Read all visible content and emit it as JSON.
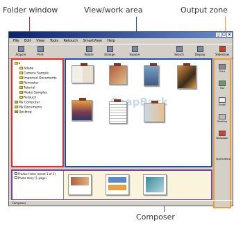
{
  "callouts": {
    "folder_window": "Folder window",
    "view_work_area": "View/work area",
    "output_zone": "Output zone",
    "composer": "Composer"
  },
  "colors": {
    "folder_border": "#e8272a",
    "view_border": "#1e4fa8",
    "output_border": "#f29a2e",
    "composer_border": "#7b3fa0"
  },
  "menu": [
    "File",
    "Edit",
    "View",
    "Tools",
    "Retouch",
    "SmartView",
    "Help"
  ],
  "toolbar": [
    {
      "label": "Acquire",
      "icon": "camera-icon"
    },
    {
      "label": "Print",
      "icon": "printer-icon"
    },
    {
      "label": "Rotate",
      "icon": "rotate-icon"
    },
    {
      "label": "Enlarge",
      "icon": "zoom-icon"
    },
    {
      "label": "Explore",
      "icon": "explore-icon"
    },
    {
      "label": "Search",
      "icon": "search-icon"
    },
    {
      "label": "Display",
      "icon": "display-icon"
    },
    {
      "label": "Slideshow",
      "icon": "slideshow-icon"
    }
  ],
  "folder_tree": [
    "Adobe",
    "Camera Sample",
    "Imported Documents",
    "Remaster",
    "Tutorial",
    "Model Samples",
    "Retouch",
    "My Computer",
    "My Documents",
    "Desktop"
  ],
  "view": {
    "watermark": "SnapBack"
  },
  "output_zone": [
    {
      "label": "Print",
      "icon": "printer-icon"
    },
    {
      "label": "Fax",
      "icon": "fax-icon"
    },
    {
      "label": "Email",
      "icon": "email-icon"
    },
    {
      "label": "Desktop",
      "icon": "desktop-icon"
    },
    {
      "label": "Wallpaper",
      "icon": "wallpaper-icon"
    },
    {
      "label": "Applications",
      "icon": "app-icon"
    }
  ],
  "composer_list": [
    "Product Intro (sheet 1 of 1)",
    "Photo story (1 page)"
  ],
  "status": "Composer"
}
